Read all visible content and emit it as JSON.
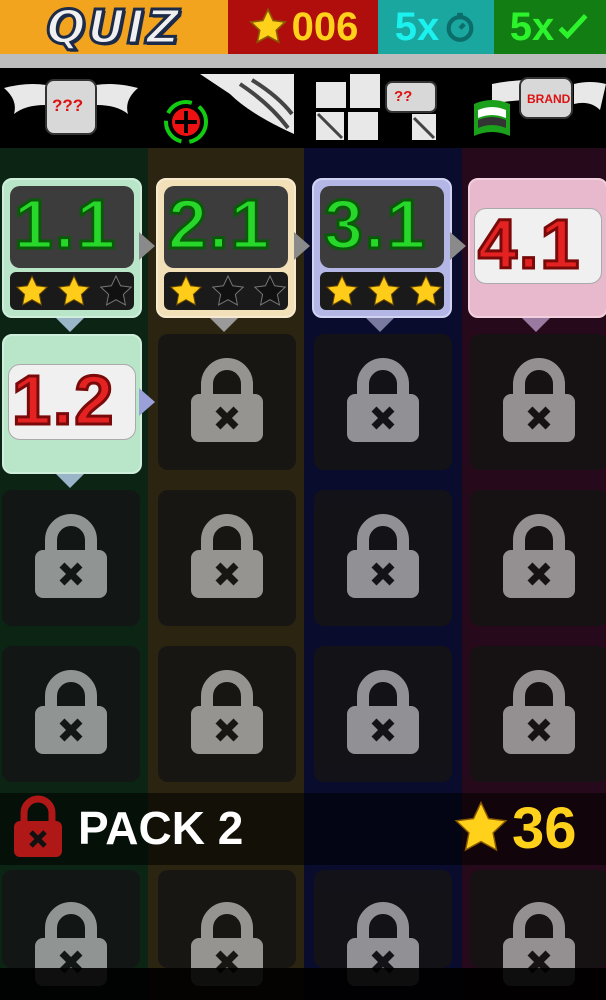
{
  "header": {
    "logo_text": "QUIZ",
    "stars_count": "006",
    "time_bonus": "5x",
    "answer_bonus": "5x"
  },
  "modes": [
    {
      "name": "unknown-logo",
      "text": "???"
    },
    {
      "name": "zoom-logo"
    },
    {
      "name": "puzzle-logo",
      "text": "??"
    },
    {
      "name": "brand-logo",
      "text": "BRAND"
    }
  ],
  "levels": [
    {
      "label": "1.1",
      "stars": 2,
      "color": "#2fd42f"
    },
    {
      "label": "2.1",
      "stars": 1,
      "color": "#2fd42f"
    },
    {
      "label": "3.1",
      "stars": 3,
      "color": "#2fd42f"
    },
    {
      "label": "4.1",
      "stars": 0,
      "color": "#d42020"
    },
    {
      "label": "1.2",
      "stars": 0,
      "color": "#d42020"
    }
  ],
  "pack": {
    "label": "PACK 2",
    "required_stars": "36"
  },
  "colors": {
    "quiz": "#f2a41f",
    "stars": "#b00d0d",
    "time": "#1aa7a0",
    "ok": "#127d12"
  }
}
